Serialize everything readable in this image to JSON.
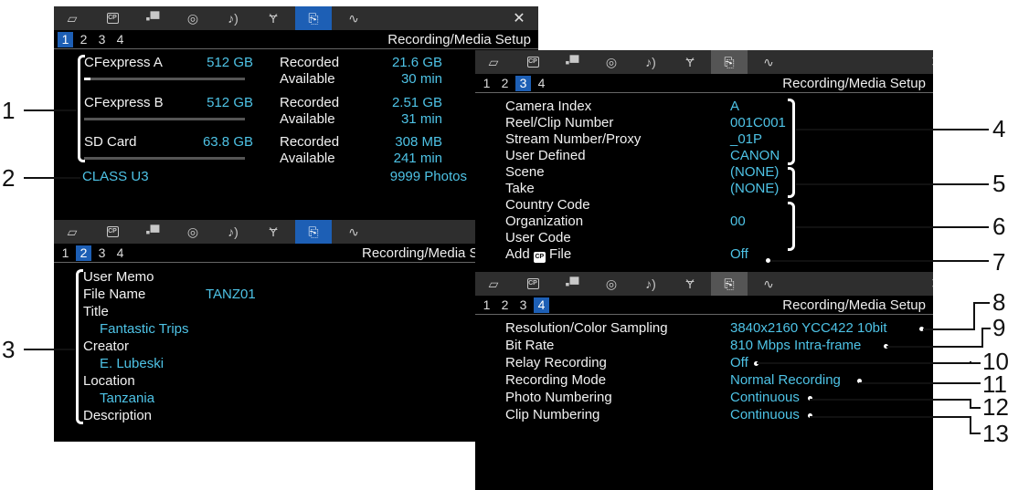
{
  "tabs": {
    "cp_label": "CP",
    "icons": [
      "camera-frame-icon",
      "cp-icon",
      "video-camera-icon",
      "color-icon",
      "audio-icon",
      "wrench-icon",
      "recording-setup-icon",
      "waveform-icon"
    ],
    "close": "✕"
  },
  "screen1": {
    "pages": [
      "1",
      "2",
      "3",
      "4"
    ],
    "subtitle": "Recording/Media Setup",
    "media": [
      {
        "name": "CFexpress A",
        "capacity": "512 GB",
        "recorded_label": "Recorded",
        "recorded": "21.6 GB",
        "available_label": "Available",
        "available": "30 min",
        "fill_fraction": 0.04
      },
      {
        "name": "CFexpress B",
        "capacity": "512 GB",
        "recorded_label": "Recorded",
        "recorded": "2.51 GB",
        "available_label": "Available",
        "available": "31 min",
        "fill_fraction": 0.0
      },
      {
        "name": "SD Card",
        "capacity": "63.8 GB",
        "recorded_label": "Recorded",
        "recorded": "308 MB",
        "available_label": "Available",
        "available": "241 min",
        "fill_fraction": 0.0
      }
    ],
    "class": "CLASS U3",
    "photos": "9999 Photos"
  },
  "screen2": {
    "pages": [
      "1",
      "2",
      "3",
      "4"
    ],
    "subtitle": "Recording/Media Setup",
    "user_memo": "User Memo",
    "file_name_label": "File Name",
    "file_name": "TANZ01",
    "title_label": "Title",
    "title": "Fantastic Trips",
    "creator_label": "Creator",
    "creator": "E. Lubeski",
    "location_label": "Location",
    "location": "Tanzania",
    "description_label": "Description"
  },
  "screen3": {
    "pages": [
      "1",
      "2",
      "3",
      "4"
    ],
    "subtitle": "Recording/Media Setup",
    "rows": [
      {
        "label": "Camera Index",
        "value": "A"
      },
      {
        "label": "Reel/Clip Number",
        "value": "001C001"
      },
      {
        "label": "Stream Number/Proxy",
        "value": "_01P"
      },
      {
        "label": "User Defined",
        "value": "CANON"
      },
      {
        "label": "Scene",
        "value": "(NONE)"
      },
      {
        "label": "Take",
        "value": "(NONE)"
      },
      {
        "label": "Country Code",
        "value": ""
      },
      {
        "label": "Organization",
        "value": "00"
      },
      {
        "label": "User Code",
        "value": ""
      }
    ],
    "add_prefix": "Add",
    "add_suffix": "File",
    "add_value": "Off"
  },
  "screen4": {
    "pages": [
      "1",
      "2",
      "3",
      "4"
    ],
    "subtitle": "Recording/Media Setup",
    "rows": [
      {
        "label": "Resolution/Color Sampling",
        "value": "3840x2160 YCC422 10bit"
      },
      {
        "label": "Bit Rate",
        "value": "810 Mbps Intra-frame"
      },
      {
        "label": "Relay Recording",
        "value": "Off"
      },
      {
        "label": "Recording Mode",
        "value": "Normal Recording"
      },
      {
        "label": "Photo Numbering",
        "value": "Continuous"
      },
      {
        "label": "Clip Numbering",
        "value": "Continuous"
      }
    ]
  },
  "callouts": [
    "1",
    "2",
    "3",
    "4",
    "5",
    "6",
    "7",
    "8",
    "9",
    "10",
    "11",
    "12",
    "13"
  ]
}
